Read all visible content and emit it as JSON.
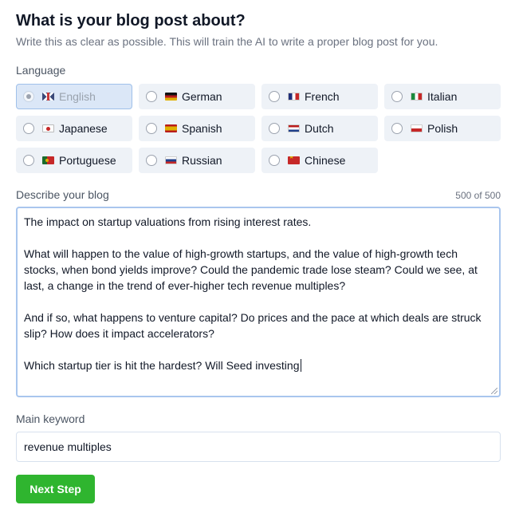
{
  "page": {
    "title": "What is your blog post about?",
    "subtitle": "Write this as clear as possible. This will train the AI to write a proper blog post for you."
  },
  "language": {
    "label": "Language",
    "selected": "English",
    "options": [
      {
        "label": "English",
        "flag": "gb-flag-icon",
        "selected": true
      },
      {
        "label": "German",
        "flag": "de-flag-icon",
        "selected": false
      },
      {
        "label": "French",
        "flag": "fr-flag-icon",
        "selected": false
      },
      {
        "label": "Italian",
        "flag": "it-flag-icon",
        "selected": false
      },
      {
        "label": "Japanese",
        "flag": "jp-flag-icon",
        "selected": false
      },
      {
        "label": "Spanish",
        "flag": "es-flag-icon",
        "selected": false
      },
      {
        "label": "Dutch",
        "flag": "nl-flag-icon",
        "selected": false
      },
      {
        "label": "Polish",
        "flag": "pl-flag-icon",
        "selected": false
      },
      {
        "label": "Portuguese",
        "flag": "pt-flag-icon",
        "selected": false
      },
      {
        "label": "Russian",
        "flag": "ru-flag-icon",
        "selected": false
      },
      {
        "label": "Chinese",
        "flag": "cn-flag-icon",
        "selected": false
      }
    ]
  },
  "description": {
    "label": "Describe your blog",
    "counter": "500 of 500",
    "value": "The impact on startup valuations from rising interest rates.\n\nWhat will happen to the value of high-growth startups, and the value of high-growth tech stocks, when bond yields improve? Could the pandemic trade lose steam? Could we see, at last, a change in the trend of ever-higher tech revenue multiples?\n\nAnd if so, what happens to venture capital? Do prices and the pace at which deals are struck slip? How does it impact accelerators?\n\nWhich startup tier is hit the hardest? Will Seed investing"
  },
  "keyword": {
    "label": "Main keyword",
    "value": "revenue multiples"
  },
  "actions": {
    "next_label": "Next Step"
  },
  "colors": {
    "primary_button": "#2fb52f",
    "focus_border": "#a9c6ee",
    "selected_option_bg": "#dbe7f7",
    "option_bg": "#eef2f7"
  }
}
